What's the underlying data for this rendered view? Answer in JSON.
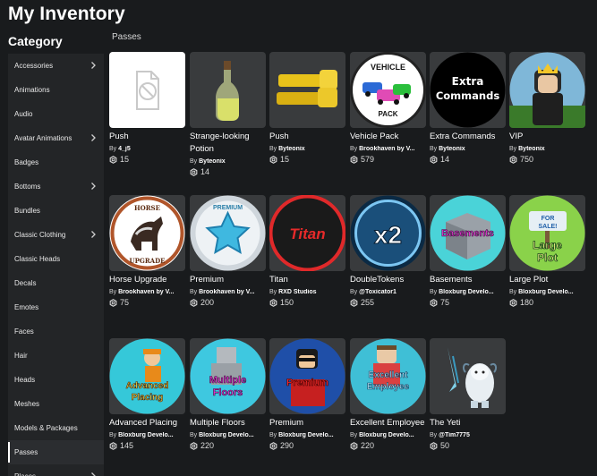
{
  "header": {
    "title": "My Inventory",
    "category_title": "Category",
    "section": "Passes"
  },
  "sidebar": {
    "items": [
      {
        "label": "Accessories",
        "chevron": true
      },
      {
        "label": "Animations",
        "chevron": false
      },
      {
        "label": "Audio",
        "chevron": false
      },
      {
        "label": "Avatar Animations",
        "chevron": true
      },
      {
        "label": "Badges",
        "chevron": false
      },
      {
        "label": "Bottoms",
        "chevron": true
      },
      {
        "label": "Bundles",
        "chevron": false
      },
      {
        "label": "Classic Clothing",
        "chevron": true
      },
      {
        "label": "Classic Heads",
        "chevron": false
      },
      {
        "label": "Decals",
        "chevron": false
      },
      {
        "label": "Emotes",
        "chevron": false
      },
      {
        "label": "Faces",
        "chevron": false
      },
      {
        "label": "Hair",
        "chevron": false
      },
      {
        "label": "Heads",
        "chevron": false
      },
      {
        "label": "Meshes",
        "chevron": false
      },
      {
        "label": "Models & Packages",
        "chevron": false
      },
      {
        "label": "Passes",
        "chevron": false,
        "active": true
      },
      {
        "label": "Places",
        "chevron": true
      }
    ]
  },
  "items": [
    {
      "name": "Push",
      "by": "By",
      "creator": "4_j5",
      "price": "15",
      "thumb": "placeholder"
    },
    {
      "name": "Strange-looking Potion",
      "by": "By",
      "creator": "Byteonix",
      "price": "14",
      "thumb": "potion"
    },
    {
      "name": "Push",
      "by": "By",
      "creator": "Byteonix",
      "price": "15",
      "thumb": "hands"
    },
    {
      "name": "Vehicle Pack",
      "by": "By",
      "creator": "Brookhaven by V...",
      "price": "579",
      "thumb": "vehicle",
      "badge_text": "VEHICLE PACK"
    },
    {
      "name": "Extra Commands",
      "by": "By",
      "creator": "Byteonix",
      "price": "14",
      "thumb": "commands",
      "badge_text": "Extra Commands"
    },
    {
      "name": "VIP",
      "by": "By",
      "creator": "Byteonix",
      "price": "750",
      "thumb": "vip"
    },
    {
      "name": "Horse Upgrade",
      "by": "By",
      "creator": "Brookhaven by V...",
      "price": "75",
      "thumb": "horse",
      "badge_text": "HORSE UPGRADE"
    },
    {
      "name": "Premium",
      "by": "By",
      "creator": "Brookhaven by V...",
      "price": "200",
      "thumb": "premium_star",
      "badge_text": "PREMIUM"
    },
    {
      "name": "Titan",
      "by": "By",
      "creator": "RXD Studios",
      "price": "150",
      "thumb": "titan",
      "badge_text": "Titan"
    },
    {
      "name": "DoubleTokens",
      "by": "By",
      "creator": "@Toxicator1",
      "price": "255",
      "thumb": "x2",
      "badge_text": "x2"
    },
    {
      "name": "Basements",
      "by": "By",
      "creator": "Bloxburg Develo...",
      "price": "75",
      "thumb": "basements",
      "badge_text": "Basements"
    },
    {
      "name": "Large Plot",
      "by": "By",
      "creator": "Bloxburg Develo...",
      "price": "180",
      "thumb": "largeplot",
      "badge_text": "Large Plot",
      "sign_text": "FOR SALE!"
    },
    {
      "name": "Advanced Placing",
      "by": "By",
      "creator": "Bloxburg Develo...",
      "price": "145",
      "thumb": "advanced",
      "badge_text": "Advanced Placing"
    },
    {
      "name": "Multiple Floors",
      "by": "By",
      "creator": "Bloxburg Develo...",
      "price": "220",
      "thumb": "floors",
      "badge_text": "Multiple Floors"
    },
    {
      "name": "Premium",
      "by": "By",
      "creator": "Bloxburg Develo...",
      "price": "290",
      "thumb": "bloxpremium",
      "badge_text": "Premium"
    },
    {
      "name": "Excellent Employee",
      "by": "By",
      "creator": "Bloxburg Develo...",
      "price": "220",
      "thumb": "employee",
      "badge_text": "Excellent Employee"
    },
    {
      "name": "The Yeti",
      "by": "By",
      "creator": "@Tim7775",
      "price": "50",
      "thumb": "yeti"
    }
  ],
  "colors": {
    "background": "#191b1d",
    "sidebar": "#232527",
    "card": "#393b3d"
  },
  "icons": {
    "price": "robux-icon",
    "chevron": "chevron-right-icon"
  }
}
